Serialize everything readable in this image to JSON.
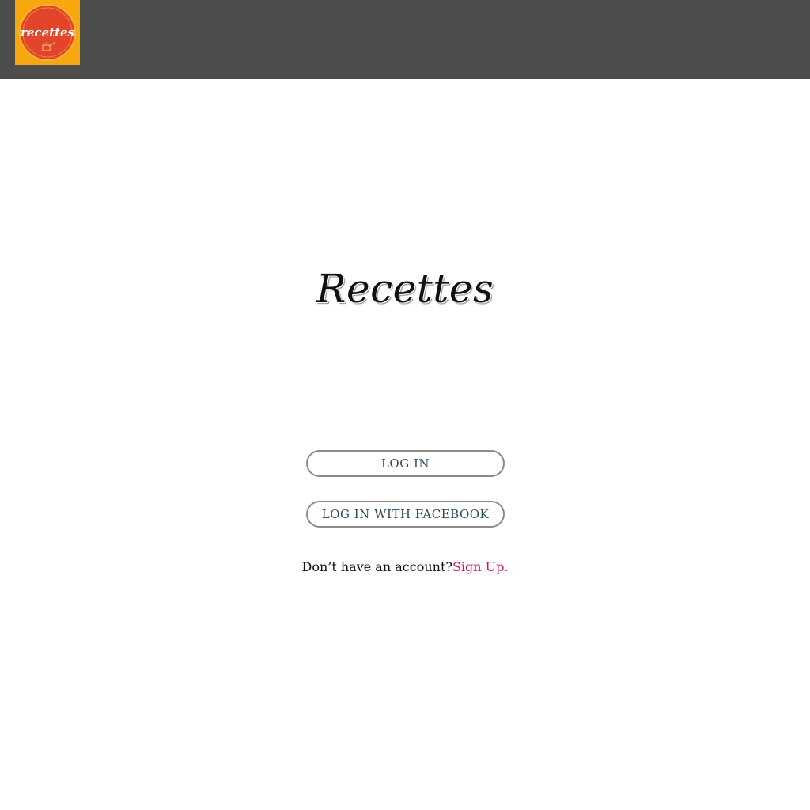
{
  "header": {
    "logo_text": "recettes",
    "colors": {
      "bar": "#4d4d4d",
      "logo_background": "#f8a70f",
      "logo_circle": "#e2452a"
    }
  },
  "main": {
    "title": "Recettes",
    "login_button": "LOG IN",
    "facebook_button": "LOG IN WITH FACEBOOK",
    "signup_prompt": "Don’t have an account?",
    "signup_link": "Sign Up."
  },
  "colors": {
    "button_text": "#2d4a5e",
    "button_border": "#8a8a8a",
    "link": "#d0166e"
  }
}
